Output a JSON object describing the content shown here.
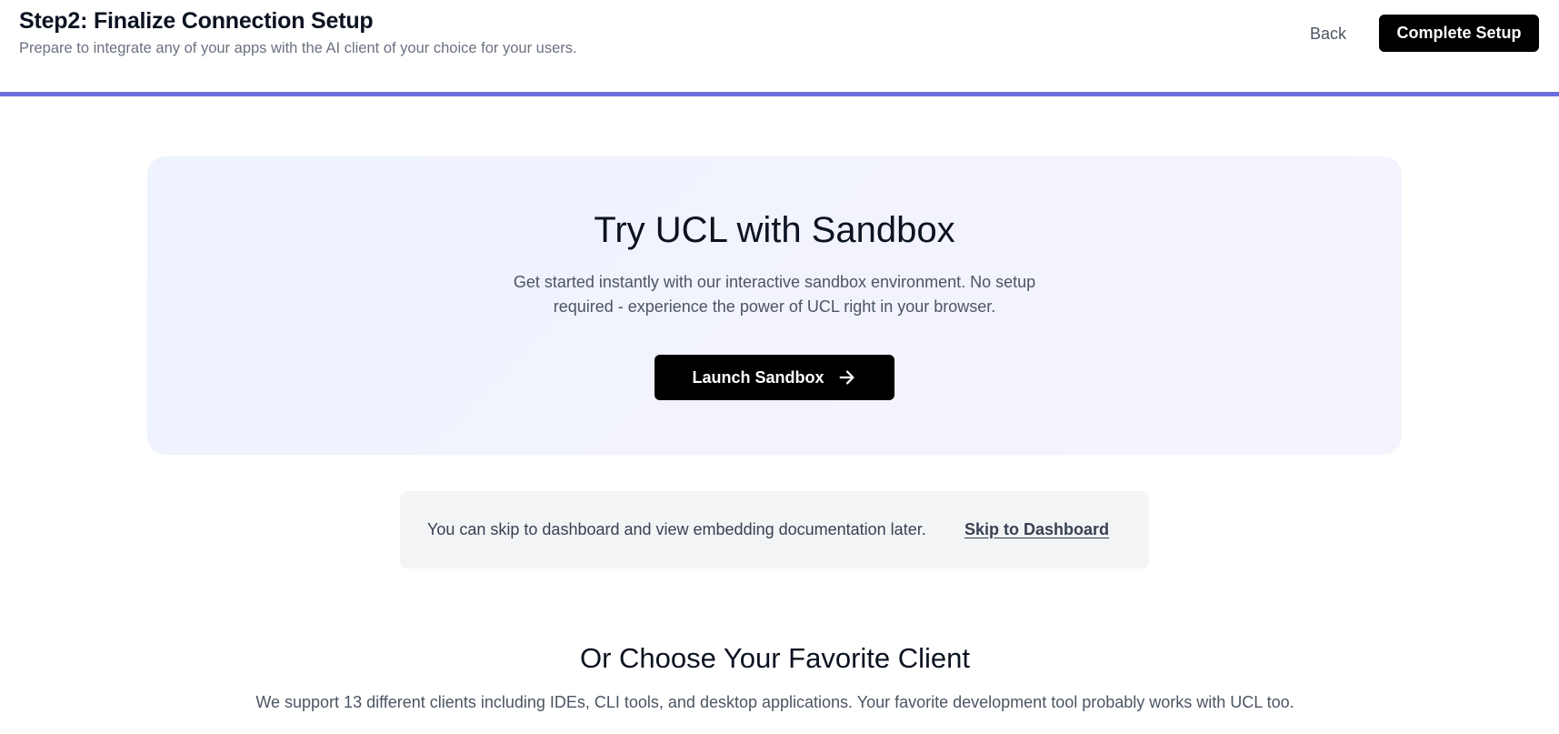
{
  "header": {
    "title": "Step2: Finalize Connection Setup",
    "subtitle": "Prepare to integrate any of your apps with the AI client of your choice for your users.",
    "back_label": "Back",
    "complete_label": "Complete Setup",
    "progress_color": "#6c6cdf"
  },
  "sandbox": {
    "title": "Try UCL with Sandbox",
    "description": "Get started instantly with our interactive sandbox environment. No setup required - experience the power of UCL right in your browser.",
    "button_label": "Launch Sandbox",
    "button_icon": "arrow-right-icon"
  },
  "skip": {
    "text": "You can skip to dashboard and view embedding documentation later.",
    "link_label": "Skip to Dashboard"
  },
  "clients": {
    "title": "Or Choose Your Favorite Client",
    "description": "We support 13 different clients including IDEs, CLI tools, and desktop applications. Your favorite development tool probably works with UCL too."
  }
}
